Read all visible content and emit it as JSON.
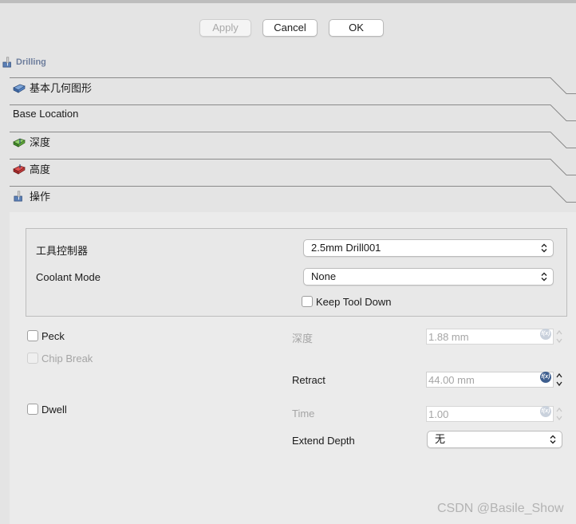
{
  "buttons": {
    "apply": "Apply",
    "cancel": "Cancel",
    "ok": "OK"
  },
  "panel_title": "Drilling",
  "sections": [
    {
      "label": "基本几何图形",
      "icon": "blue-shape-icon"
    },
    {
      "label": "Base Location",
      "icon": ""
    },
    {
      "label": "深度",
      "icon": "green-shape-icon"
    },
    {
      "label": "高度",
      "icon": "red-shape-icon"
    },
    {
      "label": "操作",
      "icon": "drill-icon"
    }
  ],
  "form": {
    "tool_controller": {
      "label": "工具控制器",
      "value": "2.5mm Drill001"
    },
    "coolant_mode": {
      "label": "Coolant Mode",
      "value": "None"
    },
    "keep_tool_down": {
      "label": "Keep Tool Down",
      "checked": false
    },
    "peck": {
      "label": "Peck",
      "checked": false
    },
    "chip_break": {
      "label": "Chip Break",
      "checked": false,
      "enabled": false
    },
    "dwell": {
      "label": "Dwell",
      "checked": false
    },
    "depth": {
      "label": "深度",
      "value": "1.88 mm",
      "enabled": false
    },
    "retract": {
      "label": "Retract",
      "value": "44.00 mm",
      "enabled": true
    },
    "time": {
      "label": "Time",
      "value": "1.00",
      "enabled": false
    },
    "extend_depth": {
      "label": "Extend Depth",
      "value": "无"
    },
    "fx_label": "f(x)"
  },
  "watermark": "CSDN @Basile_Show"
}
